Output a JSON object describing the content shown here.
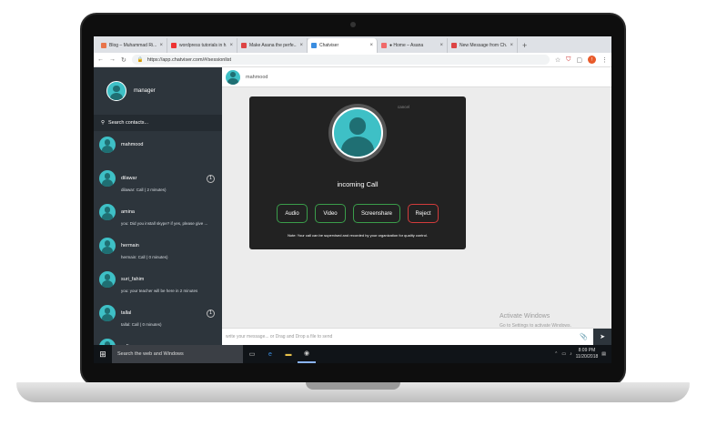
{
  "tabs": [
    {
      "label": "Blog – Muhammad Ri...",
      "color": "#e8744a"
    },
    {
      "label": "wordpress tutorials in h...",
      "color": "#e33"
    },
    {
      "label": "Make Asana the perfe...",
      "color": "#d44"
    },
    {
      "label": "Chatviser",
      "color": "#3a8de0",
      "active": true
    },
    {
      "label": "● Home – Asana",
      "color": "#f06a6a"
    },
    {
      "label": "New Message from Ch...",
      "color": "#d44"
    }
  ],
  "browser": {
    "url": "https://app.chatviser.com/#/sessionlist",
    "profile_letter": "!"
  },
  "sidebar": {
    "user": "manager",
    "search_placeholder": "Search contacts...",
    "contacts": [
      {
        "name": "mahmood",
        "msg": "",
        "badge": ""
      },
      {
        "name": "dilawar",
        "msg": "dilawar: Call ( 2 minutes)",
        "badge": "1"
      },
      {
        "name": "amina",
        "msg": "you: Did you install skype? if yes, please give ...",
        "badge": ""
      },
      {
        "name": "hermain",
        "msg": "hermain: Call ( 0 minutes)",
        "badge": ""
      },
      {
        "name": "suri_fahim",
        "msg": "you: your teacher will be here in 2 minutes",
        "badge": ""
      },
      {
        "name": "tallal",
        "msg": "tallal: Call ( 0 minutes)",
        "badge": "1"
      },
      {
        "name": "sofia",
        "msg": "",
        "badge": ""
      }
    ]
  },
  "chat": {
    "header_name": "mahmood",
    "modal": {
      "close": "cancel",
      "title": "incoming Call",
      "buttons": [
        "Audio",
        "Video",
        "Screenshare",
        "Reject"
      ],
      "note": "Note: Your call can be supervised and recorded by your organization for quality control."
    },
    "input_placeholder": "write your message... or Drag and Drop a file to send"
  },
  "watermark": {
    "line1": "Activate Windows",
    "line2": "Go to Settings to activate Windows."
  },
  "taskbar": {
    "search": "Search the web and Windows",
    "time": "8:09 PM",
    "date": "11/20/2018"
  }
}
